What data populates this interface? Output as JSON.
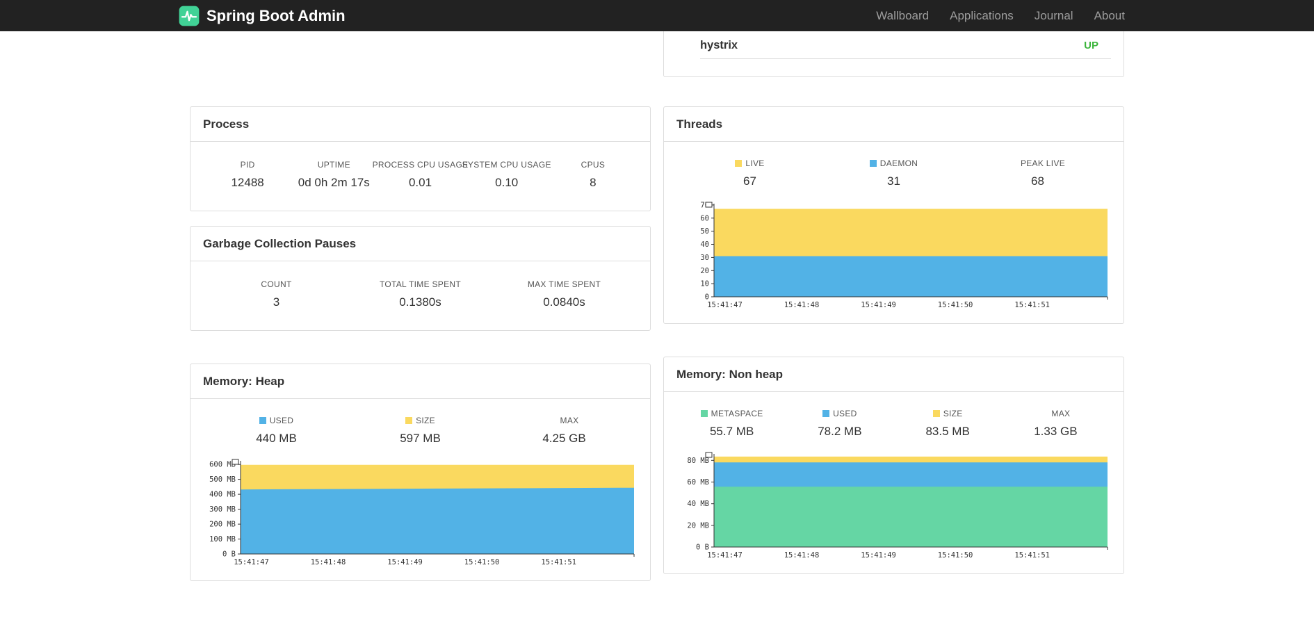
{
  "navbar": {
    "brand": "Spring Boot Admin",
    "items": [
      {
        "label": "Wallboard"
      },
      {
        "label": "Applications"
      },
      {
        "label": "Journal"
      },
      {
        "label": "About"
      }
    ]
  },
  "application": {
    "name": "hystrix",
    "status": "UP",
    "status_color": "#3cb53c"
  },
  "process": {
    "title": "Process",
    "metrics": [
      {
        "label": "PID",
        "value": "12488"
      },
      {
        "label": "UPTIME",
        "value": "0d 0h 2m 17s"
      },
      {
        "label": "PROCESS CPU USAGE",
        "value": "0.01"
      },
      {
        "label": "SYSTEM CPU USAGE",
        "value": "0.10"
      },
      {
        "label": "CPUS",
        "value": "8"
      }
    ]
  },
  "gc": {
    "title": "Garbage Collection Pauses",
    "metrics": [
      {
        "label": "COUNT",
        "value": "3"
      },
      {
        "label": "TOTAL TIME SPENT",
        "value": "0.1380s"
      },
      {
        "label": "MAX TIME SPENT",
        "value": "0.0840s"
      }
    ]
  },
  "threads": {
    "title": "Threads",
    "legend": [
      {
        "label": "LIVE",
        "value": "67",
        "color": "#fad95f"
      },
      {
        "label": "DAEMON",
        "value": "31",
        "color": "#52b2e6"
      },
      {
        "label": "PEAK LIVE",
        "value": "68",
        "color": ""
      }
    ],
    "chart_data": {
      "type": "area",
      "title": "Threads",
      "x_labels": [
        "15:41:47",
        "15:41:48",
        "15:41:49",
        "15:41:50",
        "15:41:51"
      ],
      "y_ticks": [
        {
          "v": 0,
          "label": "0"
        },
        {
          "v": 10,
          "label": "10"
        },
        {
          "v": 20,
          "label": "20"
        },
        {
          "v": 30,
          "label": "30"
        },
        {
          "v": 40,
          "label": "40"
        },
        {
          "v": 50,
          "label": "50"
        },
        {
          "v": 60,
          "label": "60"
        },
        {
          "v": 70,
          "label": "70"
        }
      ],
      "ylim": [
        0,
        71
      ],
      "series": [
        {
          "name": "LIVE",
          "color": "#fad95f",
          "values": [
            67,
            67,
            67,
            67,
            67,
            67,
            67
          ]
        },
        {
          "name": "DAEMON",
          "color": "#52b2e6",
          "values": [
            31,
            31,
            31,
            31,
            31,
            31,
            31
          ]
        }
      ]
    }
  },
  "memory_heap": {
    "title": "Memory: Heap",
    "legend": [
      {
        "label": "USED",
        "value": "440 MB",
        "color": "#52b2e6"
      },
      {
        "label": "SIZE",
        "value": "597 MB",
        "color": "#fad95f"
      },
      {
        "label": "MAX",
        "value": "4.25 GB",
        "color": ""
      }
    ],
    "chart_data": {
      "type": "area",
      "title": "Memory: Heap",
      "x_labels": [
        "15:41:47",
        "15:41:48",
        "15:41:49",
        "15:41:50",
        "15:41:51"
      ],
      "y_ticks": [
        {
          "v": 0,
          "label": "0 B"
        },
        {
          "v": 100,
          "label": "100 MB"
        },
        {
          "v": 200,
          "label": "200 MB"
        },
        {
          "v": 300,
          "label": "300 MB"
        },
        {
          "v": 400,
          "label": "400 MB"
        },
        {
          "v": 500,
          "label": "500 MB"
        },
        {
          "v": 600,
          "label": "600 MB"
        }
      ],
      "ylim": [
        0,
        624
      ],
      "series": [
        {
          "name": "SIZE",
          "color": "#fad95f",
          "values": [
            597,
            597,
            597,
            597,
            597,
            597,
            597
          ]
        },
        {
          "name": "USED",
          "color": "#52b2e6",
          "values": [
            432,
            434,
            436,
            438,
            440,
            442,
            444
          ]
        }
      ]
    }
  },
  "memory_nonheap": {
    "title": "Memory: Non heap",
    "legend": [
      {
        "label": "METASPACE",
        "value": "55.7 MB",
        "color": "#65d6a4"
      },
      {
        "label": "USED",
        "value": "78.2 MB",
        "color": "#52b2e6"
      },
      {
        "label": "SIZE",
        "value": "83.5 MB",
        "color": "#fad95f"
      },
      {
        "label": "MAX",
        "value": "1.33 GB",
        "color": ""
      }
    ],
    "chart_data": {
      "type": "area",
      "title": "Memory: Non heap",
      "x_labels": [
        "15:41:47",
        "15:41:48",
        "15:41:49",
        "15:41:50",
        "15:41:51"
      ],
      "y_ticks": [
        {
          "v": 0,
          "label": "0 B"
        },
        {
          "v": 20,
          "label": "20 MB"
        },
        {
          "v": 40,
          "label": "40 MB"
        },
        {
          "v": 60,
          "label": "60 MB"
        },
        {
          "v": 80,
          "label": "80 MB"
        }
      ],
      "ylim": [
        0,
        86
      ],
      "series": [
        {
          "name": "SIZE",
          "color": "#fad95f",
          "values": [
            83.5,
            83.5,
            83.5,
            83.5,
            83.5,
            83.5,
            83.5
          ]
        },
        {
          "name": "USED",
          "color": "#52b2e6",
          "values": [
            78.2,
            78.2,
            78.2,
            78.2,
            78.2,
            78.2,
            78.2
          ]
        },
        {
          "name": "METASPACE",
          "color": "#65d6a4",
          "values": [
            55.7,
            55.7,
            55.7,
            55.7,
            55.7,
            55.7,
            55.7
          ]
        }
      ]
    }
  }
}
